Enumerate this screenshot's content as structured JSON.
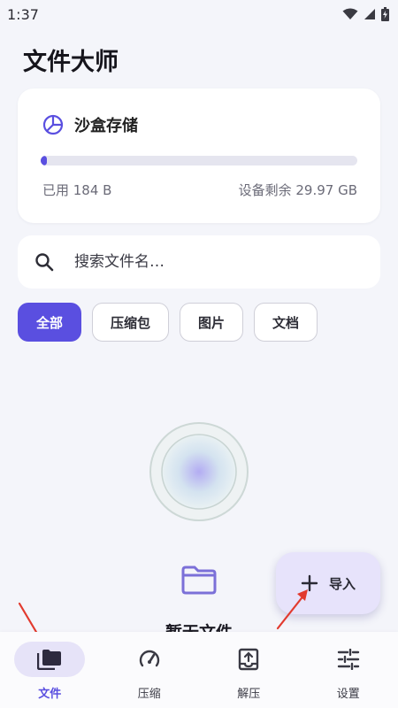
{
  "status_bar": {
    "time": "1:37"
  },
  "app": {
    "title": "文件大师"
  },
  "storage": {
    "title": "沙盒存储",
    "used": "已用 184 B",
    "free": "设备剩余 29.97 GB",
    "progress_fraction": 0.02,
    "accent_color": "#5a4fe0"
  },
  "search": {
    "placeholder": "搜索文件名…"
  },
  "filters": [
    {
      "label": "全部",
      "active": true
    },
    {
      "label": "压缩包",
      "active": false
    },
    {
      "label": "图片",
      "active": false
    },
    {
      "label": "文档",
      "active": false
    }
  ],
  "empty_state": {
    "text": "暂无文件"
  },
  "fab": {
    "label": "导入",
    "icon": "plus-icon"
  },
  "bottom_nav": [
    {
      "label": "文件",
      "icon": "folder-stack-icon",
      "active": true
    },
    {
      "label": "压缩",
      "icon": "gauge-icon",
      "active": false
    },
    {
      "label": "解压",
      "icon": "unarchive-icon",
      "active": false
    },
    {
      "label": "设置",
      "icon": "sliders-icon",
      "active": false
    }
  ]
}
